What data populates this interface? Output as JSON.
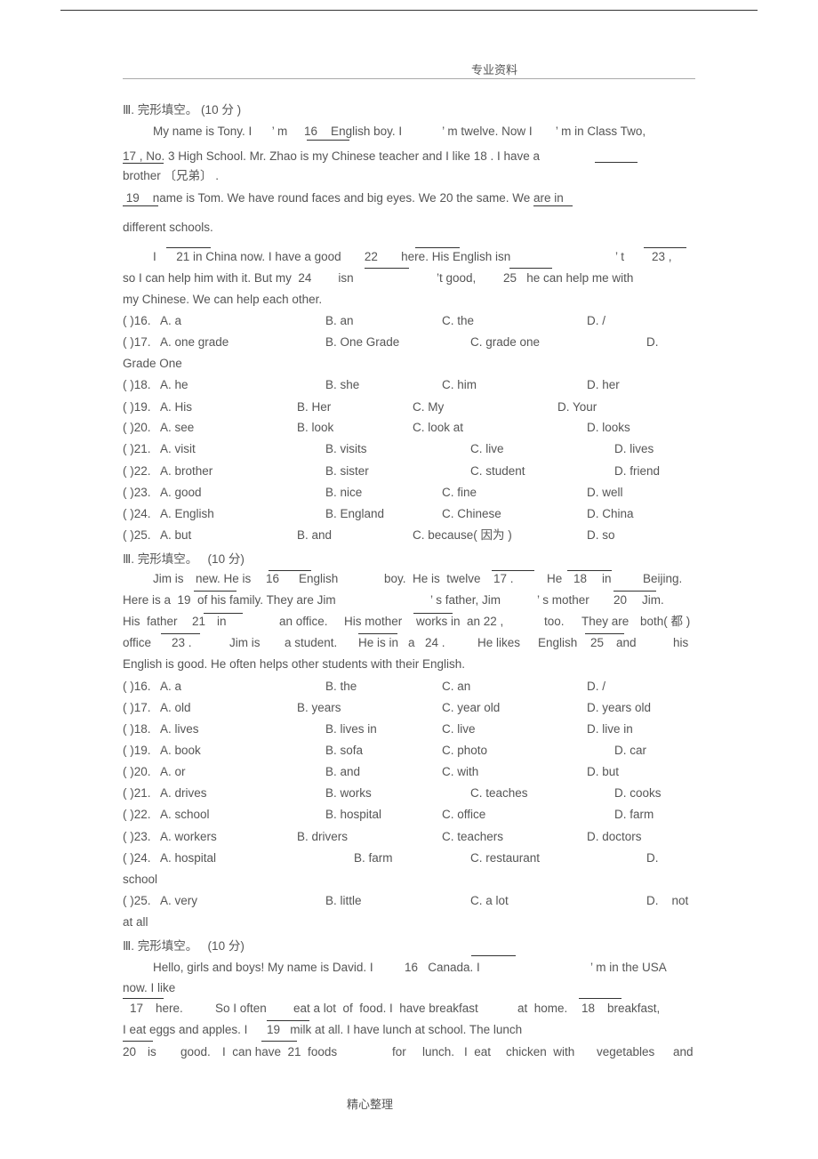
{
  "header": {
    "label": "专业资料"
  },
  "footer": {
    "label": "精心整理"
  },
  "passages": [
    {
      "title": "Ⅲ. 完形填空。 (10 分 )",
      "lines": [
        "My name is Tony. I      ’ m     16    English boy. I            ’ m twelve. Now I       ’ m in Class Two,",
        "17 , No. 3 High School. Mr. Zhao is my Chinese teacher and I like 18 . I have a",
        "brother 〔兄弟〕 .",
        " 19    name is Tom. We have round faces and big eyes. We 20 the same. We are in",
        "different schools.",
        "I      21 in China now. I have a good       22       here. His English isn",
        "so I can help him with it. But my  24        isn",
        "my Chinese. We can help each other."
      ],
      "line5_tail": [
        "’ t",
        "23 ,"
      ],
      "line6_tail": [
        "’t good,",
        "25   he can help me with"
      ],
      "questions": [
        {
          "num": "( )16.",
          "options": [
            "A. a",
            "B. an",
            "C. the",
            "D. /"
          ]
        },
        {
          "num": "( )17.",
          "options": [
            "A. one grade",
            "B. One Grade",
            "C. grade one",
            "D."
          ],
          "wrap": "Grade One"
        },
        {
          "num": "( )18.",
          "options": [
            "A. he",
            "B. she",
            "C. him",
            "D. her"
          ]
        },
        {
          "num": "( )19.",
          "options": [
            "A. His",
            "B. Her",
            "C. My",
            "D. Your"
          ]
        },
        {
          "num": "( )20.",
          "options": [
            "A. see",
            "B. look",
            "C. look at",
            "D. looks"
          ]
        },
        {
          "num": "( )21.",
          "options": [
            "A. visit",
            "B. visits",
            "C. live",
            "D. lives"
          ]
        },
        {
          "num": "( )22.",
          "options": [
            "A. brother",
            "B. sister",
            "C. student",
            "D. friend"
          ]
        },
        {
          "num": "( )23.",
          "options": [
            "A. good",
            "B. nice",
            "C. fine",
            "D. well"
          ]
        },
        {
          "num": "( )24.",
          "options": [
            "A. English",
            "B. England",
            "C. Chinese",
            "D. China"
          ]
        },
        {
          "num": "( )25.",
          "options": [
            "A. but",
            "B. and",
            "C. because( 因为 )",
            "D. so"
          ]
        }
      ]
    },
    {
      "title": "Ⅲ. 完形填空。   (10 分)",
      "lines": [
        [
          "Jim is",
          "new. He is",
          "16",
          "English",
          "boy.  He is  twelve",
          "17 .",
          "He",
          "18",
          "in",
          "Beijing."
        ],
        [
          "Here is a  19  of his family. They are Jim",
          "’ s father, Jim",
          "’ s mother",
          "20",
          "Jim."
        ],
        [
          "His  father",
          "21",
          "in",
          "an office.",
          "His mother",
          "works in  an 22 ,",
          "too.",
          "They are",
          "both( 都 )"
        ],
        [
          "office",
          "23 .",
          "Jim is",
          "a student.",
          "He is in",
          "a",
          "24 .",
          "He likes",
          "English",
          "25",
          "and",
          "his"
        ],
        [
          "English is good. He often helps other students with their English."
        ]
      ],
      "questions": [
        {
          "num": "( )16.",
          "options": [
            "A. a",
            "B. the",
            "C. an",
            "D. /"
          ]
        },
        {
          "num": "( )17.",
          "options": [
            "A. old",
            "B. years",
            "C. year old",
            "D. years old"
          ]
        },
        {
          "num": "( )18.",
          "options": [
            "A. lives",
            "B. lives in",
            "C. live",
            "D. live in"
          ]
        },
        {
          "num": "( )19.",
          "options": [
            "A. book",
            "B. sofa",
            "C. photo",
            "D. car"
          ]
        },
        {
          "num": "( )20.",
          "options": [
            "A. or",
            "B. and",
            "C. with",
            "D. but"
          ]
        },
        {
          "num": "( )21.",
          "options": [
            "A. drives",
            "B. works",
            "C. teaches",
            "D. cooks"
          ]
        },
        {
          "num": "( )22.",
          "options": [
            "A. school",
            "B. hospital",
            "C. office",
            "D. farm"
          ]
        },
        {
          "num": "( )23.",
          "options": [
            "A. workers",
            "B. drivers",
            "C. teachers",
            "D. doctors"
          ]
        },
        {
          "num": "( )24.",
          "options": [
            "A. hospital",
            "B. farm",
            "C. restaurant",
            "D."
          ],
          "wrap": "school"
        },
        {
          "num": "( )25.",
          "options": [
            "A. very",
            "B. little",
            "C. a lot",
            "D.    not"
          ],
          "wrap": "at all"
        }
      ]
    },
    {
      "title": "Ⅲ. 完形填空。   (10 分)",
      "lines": [
        [
          "Hello, girls and boys! My name is David. I",
          "16   Canada. I",
          "’ m in the USA"
        ],
        [
          "now. I like"
        ],
        [
          "17",
          "here.",
          "So I often",
          "eat a lot  of  food.",
          "I  have breakfast",
          "at  home.",
          "18",
          "breakfast,"
        ],
        [
          "I eat eggs and apples. I",
          "19   milk at all. I have lunch at school. The lunch"
        ],
        [
          "20",
          "is",
          "good.",
          "I  can have  21  foods",
          "for",
          "lunch.",
          "I  eat",
          "chicken  with",
          "vegetables",
          "and"
        ]
      ]
    }
  ]
}
